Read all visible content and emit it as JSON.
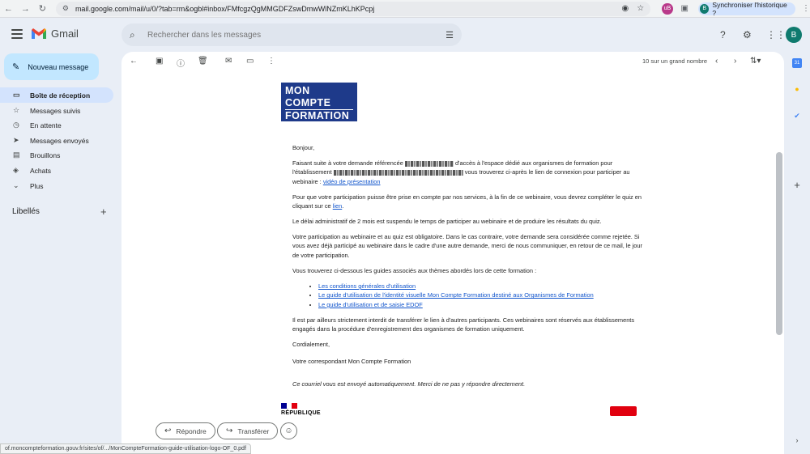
{
  "browser": {
    "url": "mail.google.com/mail/u/0/?tab=rm&ogbl#inbox/FMfcgzQgMMGDFZswDmwWlNZmKLhKPcpj",
    "ext_label": "uB",
    "sync_avatar": "B",
    "sync_label": "Synchroniser l'historique ?"
  },
  "header": {
    "logo_text": "Gmail",
    "search_placeholder": "Rechercher dans les messages",
    "user_initial": "B"
  },
  "sidebar": {
    "compose_label": "Nouveau message",
    "items": [
      {
        "label": "Boîte de réception",
        "icon": "inbox-icon"
      },
      {
        "label": "Messages suivis",
        "icon": "star-icon"
      },
      {
        "label": "En attente",
        "icon": "clock-icon"
      },
      {
        "label": "Messages envoyés",
        "icon": "send-icon"
      },
      {
        "label": "Brouillons",
        "icon": "draft-icon"
      },
      {
        "label": "Achats",
        "icon": "tag-icon"
      },
      {
        "label": "Plus",
        "icon": "chevron-down-icon"
      }
    ],
    "labels_title": "Libellés"
  },
  "toolbar": {
    "pager_text": "10 sur un grand nombre"
  },
  "email": {
    "logo_lines": [
      "MON",
      "COMPTE",
      "FORMATION"
    ],
    "greeting": "Bonjour,",
    "p1_a": "Faisant suite à votre demande référencée",
    "p1_b": "d'accès à l'espace dédié aux organismes de formation pour l'établissement",
    "p1_c": "vous trouverez ci-après le lien de connexion pour participer au webinaire :",
    "p1_link": "vidéo de présentation",
    "p2_a": "Pour que votre participation puisse être prise en compte par nos services, à la fin de ce webinaire, vous devrez compléter le quiz en cliquant sur ce",
    "p2_link": "lien",
    "p3": "Le délai administratif de 2 mois est suspendu le temps de participer au webinaire et de produire les résultats du quiz.",
    "p4": "Votre participation au webinaire et au quiz est obligatoire. Dans le cas contraire, votre demande sera considérée comme rejetée. Si vous avez déjà participé au webinaire dans le cadre d'une autre demande, merci de nous communiquer, en retour de ce mail, le jour de votre participation.",
    "p5": "Vous trouverez ci-dessous les guides associés aux thèmes abordés lors de cette formation :",
    "guides": [
      "Les conditions générales d'utilisation",
      "Le guide d'utilisation de l'identité visuelle Mon Compte Formation destiné aux Organismes de Formation",
      "Le guide d'utilisation et de saisie EDOF"
    ],
    "p6": "Il est par ailleurs strictement interdit de transférer le lien à d'autres participants. Ces webinaires sont réservés aux établissements engagés dans la procédure d'enregistrement des organismes de formation uniquement.",
    "closing": "Cordialement,",
    "signature": "Votre correspondant Mon Compte Formation",
    "auto_note": "Ce courriel vous est envoyé automatiquement. Merci de ne pas y répondre directement.",
    "republique": "RÉPUBLIQUE"
  },
  "actions": {
    "reply_label": "Répondre",
    "forward_label": "Transférer"
  },
  "status_url": "of.moncompteformation.gouv.fr/sites/of/.../MonCompteFormation-guide-utilisation-logo-OF_0.pdf",
  "colors": {
    "accent": "#c2e7ff",
    "active_nav": "#d3e3fd",
    "link": "#1155cc",
    "mcf_blue": "#1e3a8a"
  }
}
